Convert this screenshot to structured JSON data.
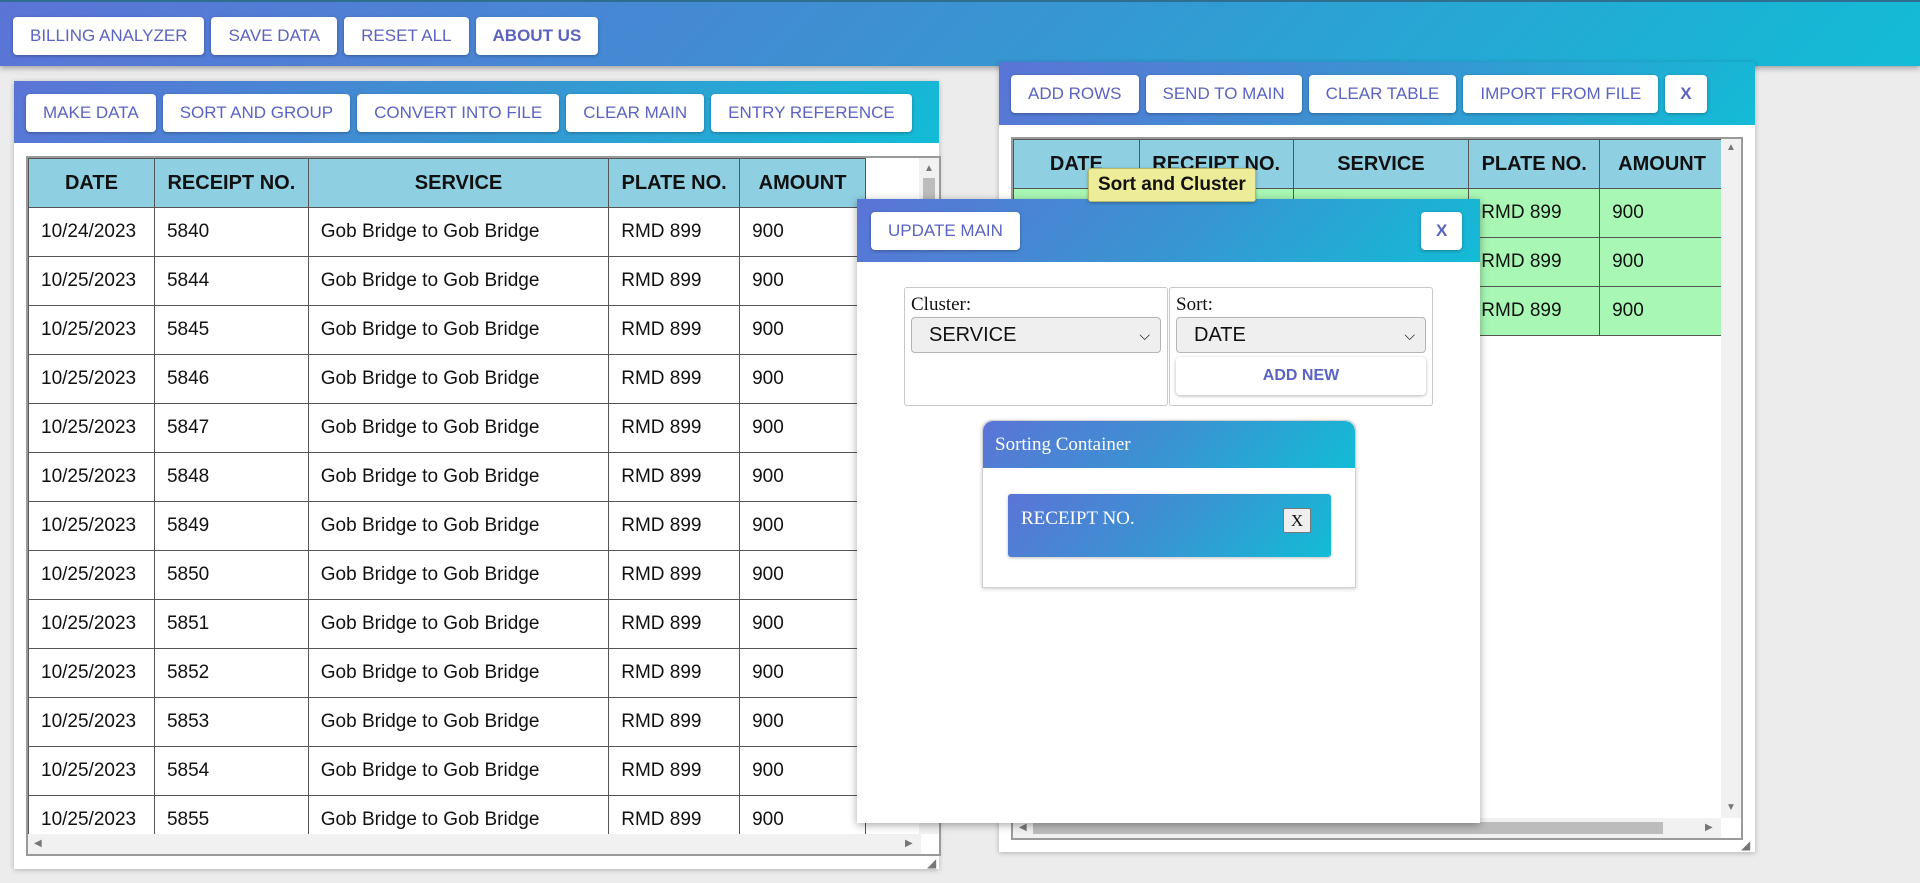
{
  "nav": {
    "buttons": [
      "BILLING ANALYZER",
      "SAVE DATA",
      "RESET ALL",
      "ABOUT US"
    ]
  },
  "main_panel": {
    "toolbar": [
      "MAKE DATA",
      "SORT AND GROUP",
      "CONVERT INTO FILE",
      "CLEAR MAIN",
      "ENTRY REFERENCE"
    ],
    "columns": [
      "DATE",
      "RECEIPT NO.",
      "SERVICE",
      "PLATE NO.",
      "AMOUNT"
    ],
    "rows": [
      [
        "10/24/2023",
        "5840",
        "Gob Bridge to Gob Bridge",
        "RMD 899",
        "900"
      ],
      [
        "10/25/2023",
        "5844",
        "Gob Bridge to Gob Bridge",
        "RMD 899",
        "900"
      ],
      [
        "10/25/2023",
        "5845",
        "Gob Bridge to Gob Bridge",
        "RMD 899",
        "900"
      ],
      [
        "10/25/2023",
        "5846",
        "Gob Bridge to Gob Bridge",
        "RMD 899",
        "900"
      ],
      [
        "10/25/2023",
        "5847",
        "Gob Bridge to Gob Bridge",
        "RMD 899",
        "900"
      ],
      [
        "10/25/2023",
        "5848",
        "Gob Bridge to Gob Bridge",
        "RMD 899",
        "900"
      ],
      [
        "10/25/2023",
        "5849",
        "Gob Bridge to Gob Bridge",
        "RMD 899",
        "900"
      ],
      [
        "10/25/2023",
        "5850",
        "Gob Bridge to Gob Bridge",
        "RMD 899",
        "900"
      ],
      [
        "10/25/2023",
        "5851",
        "Gob Bridge to Gob Bridge",
        "RMD 899",
        "900"
      ],
      [
        "10/25/2023",
        "5852",
        "Gob Bridge to Gob Bridge",
        "RMD 899",
        "900"
      ],
      [
        "10/25/2023",
        "5853",
        "Gob Bridge to Gob Bridge",
        "RMD 899",
        "900"
      ],
      [
        "10/25/2023",
        "5854",
        "Gob Bridge to Gob Bridge",
        "RMD 899",
        "900"
      ],
      [
        "10/25/2023",
        "5855",
        "Gob Bridge to Gob Bridge",
        "RMD 899",
        "900"
      ]
    ]
  },
  "side_panel": {
    "toolbar": [
      "ADD ROWS",
      "SEND TO MAIN",
      "CLEAR TABLE",
      "IMPORT FROM FILE"
    ],
    "close_label": "X",
    "columns": [
      "DATE",
      "RECEIPT NO.",
      "SERVICE",
      "PLATE NO.",
      "AMOUNT"
    ],
    "rows": [
      [
        "",
        "",
        "",
        "RMD 899",
        "900"
      ],
      [
        "",
        "",
        "",
        "RMD 899",
        "900"
      ],
      [
        "",
        "",
        "",
        "RMD 899",
        "900"
      ]
    ],
    "row_color": "#a8f7b4"
  },
  "sort_dialog": {
    "tooltip": "Sort and Cluster",
    "update_label": "UPDATE MAIN",
    "close_label": "X",
    "cluster_label": "Cluster:",
    "cluster_value": "SERVICE",
    "sort_label": "Sort:",
    "sort_value": "DATE",
    "add_new_label": "ADD NEW",
    "container_title": "Sorting Container",
    "chips": [
      {
        "label": "RECEIPT NO.",
        "close": "X"
      }
    ]
  },
  "colors": {
    "accent_button_text": "#5b63c2",
    "header_gradient_start": "#5b74d6",
    "header_gradient_end": "#12bcd6",
    "table_header": "#8ecfe2",
    "tooltip_bg": "#ecec99"
  },
  "icons": [
    "chevron-down-icon",
    "scroll-arrow-icon",
    "resize-grip-icon"
  ]
}
